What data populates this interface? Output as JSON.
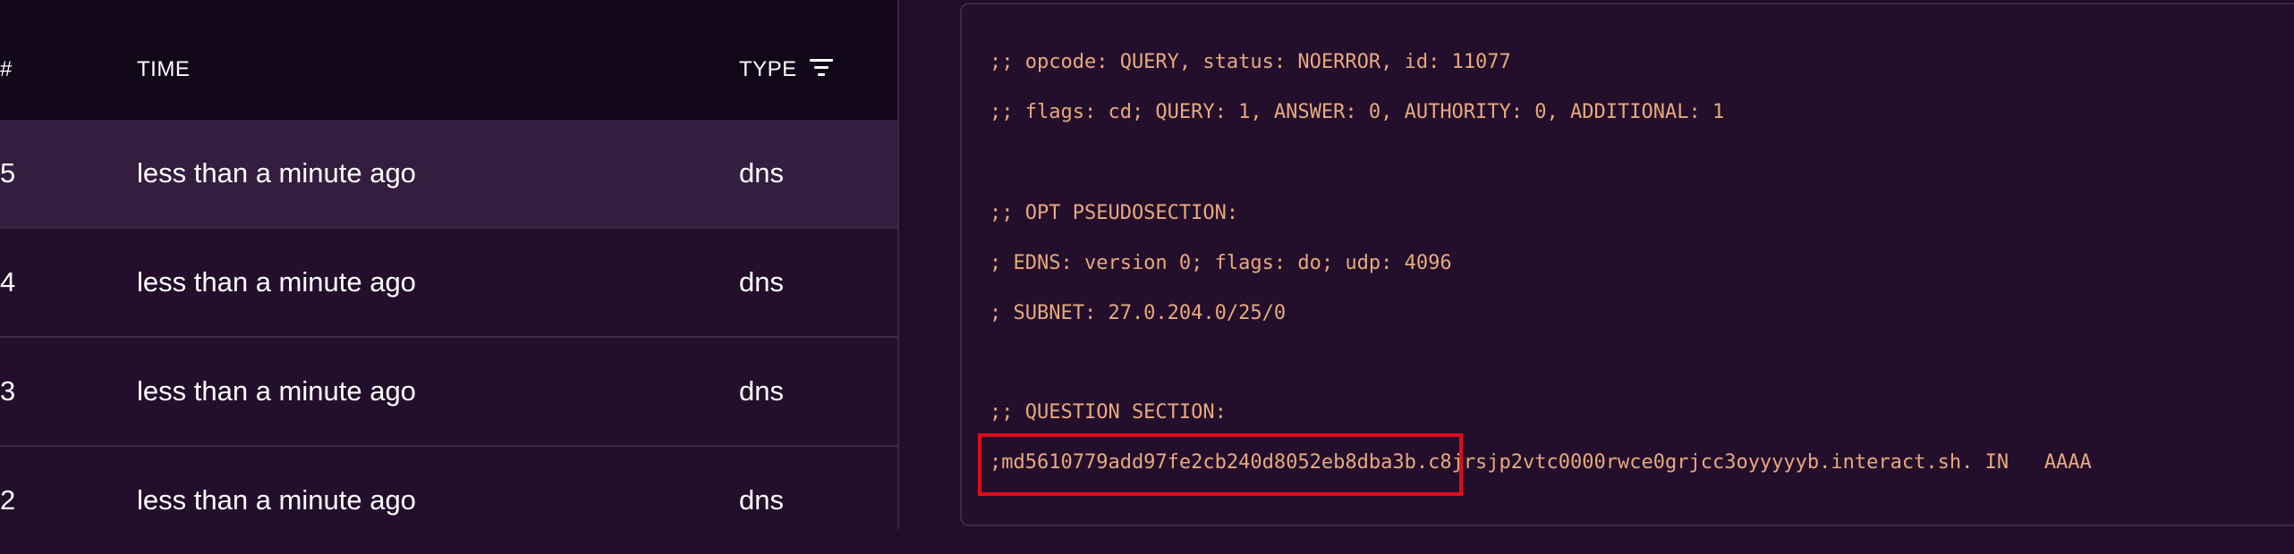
{
  "table": {
    "headers": {
      "id": "#",
      "time": "TIME",
      "type": "TYPE"
    },
    "rows": [
      {
        "id": "5",
        "time": "less than a minute ago",
        "type": "dns"
      },
      {
        "id": "4",
        "time": "less than a minute ago",
        "type": "dns"
      },
      {
        "id": "3",
        "time": "less than a minute ago",
        "type": "dns"
      },
      {
        "id": "2",
        "time": "less than a minute ago",
        "type": "dns"
      }
    ]
  },
  "detail": {
    "lines": [
      ";; opcode: QUERY, status: NOERROR, id: 11077",
      ";; flags: cd; QUERY: 1, ANSWER: 0, AUTHORITY: 0, ADDITIONAL: 1",
      ";; OPT PSEUDOSECTION:",
      "; EDNS: version 0; flags: do; udp: 4096",
      "; SUBNET: 27.0.204.0/25/0",
      ";; QUESTION SECTION:",
      ";md5610779add97fe2cb240d8052eb8dba3b.c8jrsjp2vtc0000rwce0grjcc3oyyyyyb.interact.sh. IN   AAAA"
    ]
  },
  "colors": {
    "background": "#210d2a",
    "header_bg": "#13071a",
    "selected_row": "#341d3f",
    "code_text": "#e8a97c",
    "highlight": "#e00b1c"
  }
}
